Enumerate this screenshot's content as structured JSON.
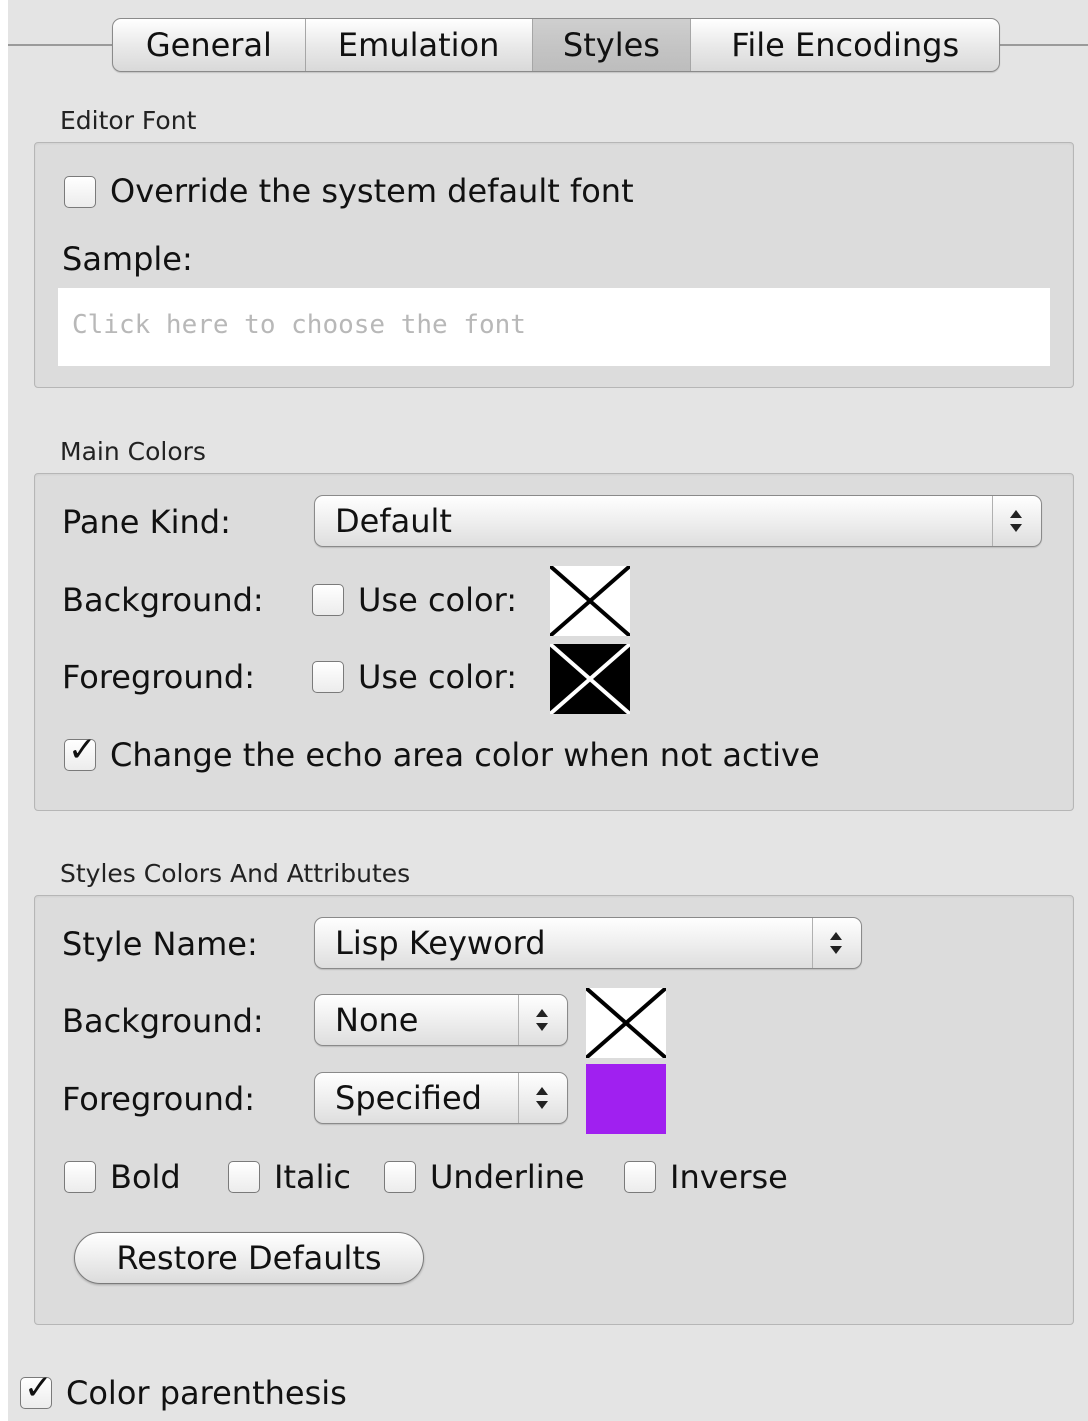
{
  "tabs": [
    "General",
    "Emulation",
    "Styles",
    "File Encodings"
  ],
  "selected_tab": "Styles",
  "editor_font": {
    "title": "Editor Font",
    "override_label": "Override the system default font",
    "override_checked": false,
    "sample_label": "Sample:",
    "sample_placeholder": "Click here to choose the font"
  },
  "main_colors": {
    "title": "Main Colors",
    "pane_kind_label": "Pane Kind:",
    "pane_kind_value": "Default",
    "background_label": "Background:",
    "background_use_color_label": "Use color:",
    "background_use_color_checked": false,
    "foreground_label": "Foreground:",
    "foreground_use_color_label": "Use color:",
    "foreground_use_color_checked": false,
    "echo_label": "Change the echo area color when not active",
    "echo_checked": true
  },
  "styles": {
    "title": "Styles Colors And Attributes",
    "style_name_label": "Style Name:",
    "style_name_value": "Lisp Keyword",
    "background_label": "Background:",
    "background_value": "None",
    "foreground_label": "Foreground:",
    "foreground_value": "Specified",
    "foreground_color": "#a020f0",
    "bold_label": "Bold",
    "italic_label": "Italic",
    "underline_label": "Underline",
    "inverse_label": "Inverse",
    "restore_label": "Restore Defaults"
  },
  "color_parenthesis": {
    "label": "Color parenthesis",
    "checked": true
  }
}
